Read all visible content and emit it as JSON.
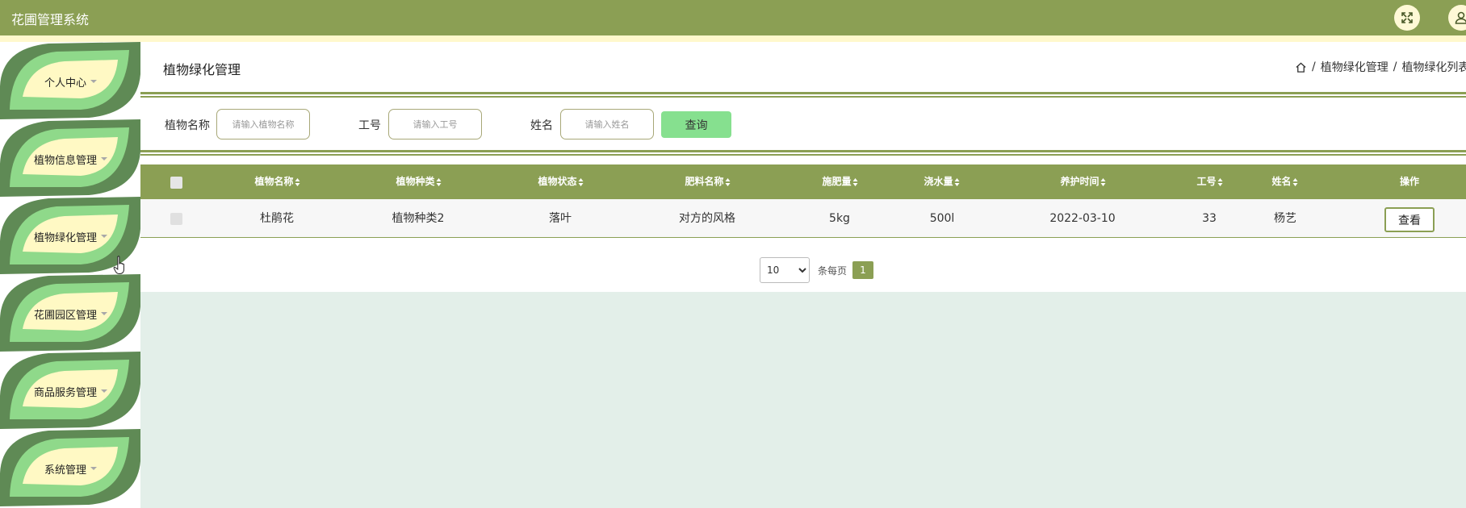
{
  "app": {
    "title": "花圃管理系统"
  },
  "colors": {
    "primary": "#8b9f54",
    "accent_green": "#86e08f",
    "sidebar_leaf_dark": "#5f8a55",
    "sidebar_leaf_light": "#8fd98a",
    "sidebar_leaf_center": "#fff9c4",
    "content_bg": "#e3efe9"
  },
  "header": {
    "icons": [
      "fullscreen-icon",
      "user-icon"
    ]
  },
  "sidebar": {
    "items": [
      {
        "label": "个人中心"
      },
      {
        "label": "植物信息管理"
      },
      {
        "label": "植物绿化管理"
      },
      {
        "label": "花圃园区管理"
      },
      {
        "label": "商品服务管理"
      },
      {
        "label": "系统管理"
      }
    ]
  },
  "main": {
    "page_title": "植物绿化管理",
    "breadcrumb": [
      "植物绿化管理",
      "植物绿化列表"
    ]
  },
  "filters": {
    "plant_name_label": "植物名称",
    "plant_name_placeholder": "请输入植物名称",
    "worker_id_label": "工号",
    "worker_id_placeholder": "请输入工号",
    "name_label": "姓名",
    "name_placeholder": "请输入姓名",
    "search_button": "查询"
  },
  "table": {
    "columns": [
      "植物名称",
      "植物种类",
      "植物状态",
      "肥料名称",
      "施肥量",
      "浇水量",
      "养护时间",
      "工号",
      "姓名",
      "操作"
    ],
    "rows": [
      {
        "plant_name": "杜鹃花",
        "plant_type": "植物种类2",
        "plant_status": "落叶",
        "fertilizer": "对方的风格",
        "fertilizer_amount": "5kg",
        "water_amount": "500l",
        "care_time": "2022-03-10",
        "worker_id": "33",
        "name": "杨艺",
        "action": "查看"
      }
    ]
  },
  "pagination": {
    "page_size_value": "10",
    "page_size_options": [
      "10"
    ],
    "per_page_label": "条每页",
    "current_page": "1"
  }
}
